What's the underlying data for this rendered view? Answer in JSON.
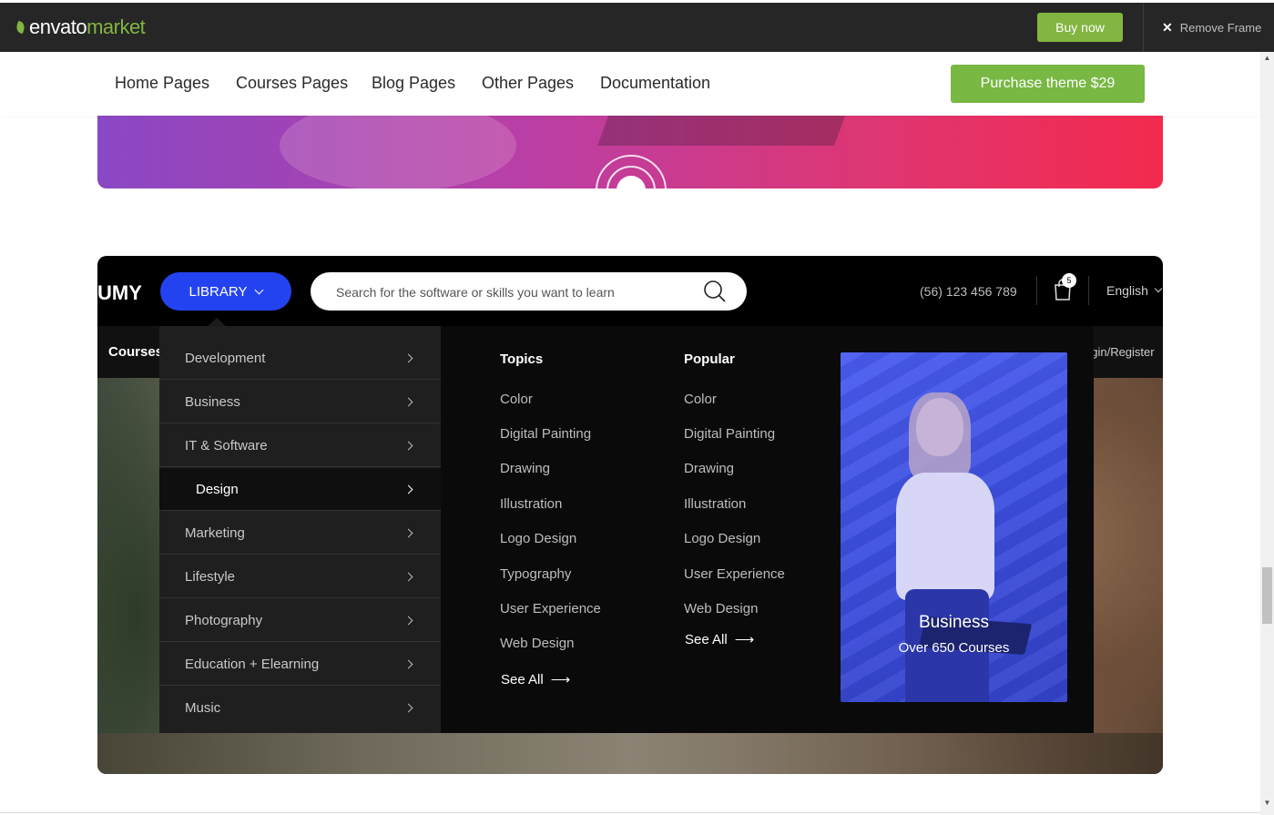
{
  "envato": {
    "logo_main": "envato",
    "logo_accent": "market",
    "buy_now": "Buy now",
    "remove_frame": "Remove Frame"
  },
  "nav": {
    "items": [
      "Home Pages",
      "Courses Pages",
      "Blog Pages",
      "Other Pages",
      "Documentation"
    ],
    "purchase": "Purchase theme $29"
  },
  "header": {
    "brand": "UMY",
    "library": "LIBRARY",
    "search_placeholder": "Search for the software or skills you want to learn",
    "phone": "(56) 123 456 789",
    "cart_count": "5",
    "language": "English",
    "subnav_courses": "Courses",
    "subnav_login": "ogin/Register"
  },
  "menu": {
    "categories": [
      "Development",
      "Business",
      "IT & Software",
      "Design",
      "Marketing",
      "Lifestyle",
      "Photography",
      "Education + Elearning",
      "Music"
    ],
    "active_category": "Design",
    "topics": {
      "title": "Topics",
      "links": [
        "Color",
        "Digital Painting",
        "Drawing",
        "Illustration",
        "Logo Design",
        "Typography",
        "User Experience",
        "Web Design"
      ],
      "see_all": "See All"
    },
    "popular": {
      "title": "Popular",
      "links": [
        "Color",
        "Digital Painting",
        "Drawing",
        "Illustration",
        "Logo Design",
        "User Experience",
        "Web Design"
      ],
      "see_all": "See All"
    },
    "promo": {
      "title": "Business",
      "subtitle": "Over 650 Courses"
    }
  },
  "colors": {
    "envato_green": "#82b541",
    "purchase_green": "#78b843",
    "library_blue": "#2443f0"
  }
}
